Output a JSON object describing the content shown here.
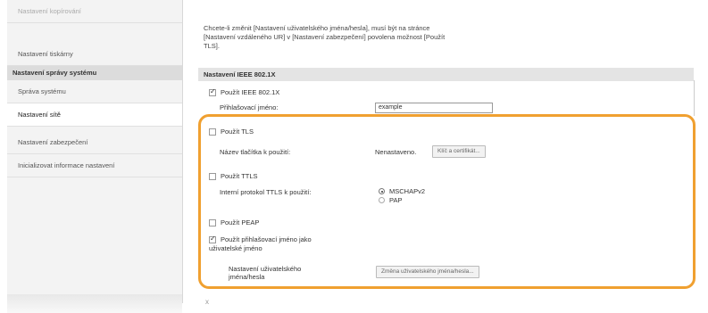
{
  "sidebar": {
    "items_top": [
      {
        "label": "Nastavení kopírování"
      },
      {
        "label": "Nastavení tiskárny"
      }
    ],
    "section_label": "Nastavení správy systému",
    "items": [
      {
        "label": "Správa systému"
      },
      {
        "label": "Nastavení sítě"
      },
      {
        "label": "Nastavení zabezpečení"
      },
      {
        "label": "Inicializovat informace nastavení"
      }
    ]
  },
  "description": {
    "line1": "Chcete-li změnit [Nastavení uživatelského jména/hesla], musí být na stránce",
    "line2": "[Nastavení vzdáleného UR] v [Nastavení zabezpečení] povolena možnost [Použít",
    "line3": "TLS]."
  },
  "section": {
    "title": "Nastavení IEEE 802.1X",
    "use_ieee": "Použít IEEE 802.1X",
    "login_name_label": "Přihlašovací jméno:",
    "login_name_value": "example",
    "use_tls": "Použít TLS",
    "key_name_label": "Název tlačítka k použití:",
    "key_name_value": "Nenastaveno.",
    "key_cert_button": "Klíč a certifikát...",
    "use_ttls": "Použít TTLS",
    "ttls_protocol_label": "Interní protokol TTLS k použití:",
    "ttls_options": [
      "MSCHAPv2",
      "PAP"
    ],
    "use_peap": "Použít PEAP",
    "use_login_as_user_line1": "Použít přihlašovací jméno jako",
    "use_login_as_user_line2": "uživatelské jméno",
    "user_settings_line1": "Nastavení uživatelského",
    "user_settings_line2": "jména/hesla",
    "change_user_button": "Změna uživatelského jména/hesla..."
  },
  "footer": {
    "mark": "x"
  },
  "colors": {
    "highlight": "#f0a030"
  }
}
